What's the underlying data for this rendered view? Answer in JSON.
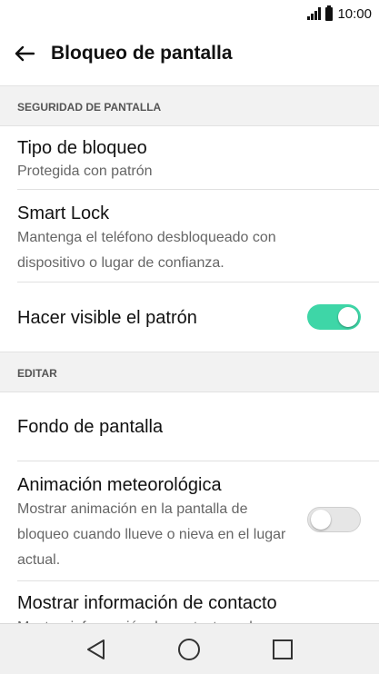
{
  "status_bar": {
    "time": "10:00"
  },
  "app_bar": {
    "title": "Bloqueo de pantalla"
  },
  "sections": {
    "security": {
      "header": "SEGURIDAD DE PANTALLA",
      "items": [
        {
          "title": "Tipo de bloqueo",
          "subtitle": "Protegida con patrón"
        },
        {
          "title": "Smart Lock",
          "subtitle": "Mantenga el teléfono desbloqueado con dispositivo o lugar de confianza."
        },
        {
          "title": "Hacer visible el patrón",
          "toggle": "on"
        }
      ]
    },
    "edit": {
      "header": "EDITAR",
      "items": [
        {
          "title": "Fondo de pantalla"
        },
        {
          "title": "Animación meteorológica",
          "subtitle": "Mostrar animación en la pantalla de bloqueo cuando llueve o nieva en el lugar actual.",
          "toggle": "off"
        },
        {
          "title": "Mostrar información de contacto",
          "subtitle": "Mostrar información de contacto en la"
        }
      ]
    }
  },
  "colors": {
    "accent": "#3ed6a7",
    "nav_bar": "#f0f0f0",
    "section_bg": "#f2f2f2"
  },
  "icons": {
    "back": "arrow-left-icon",
    "nav_back": "triangle-back-icon",
    "nav_home": "circle-home-icon",
    "nav_recent": "square-recent-icon"
  }
}
